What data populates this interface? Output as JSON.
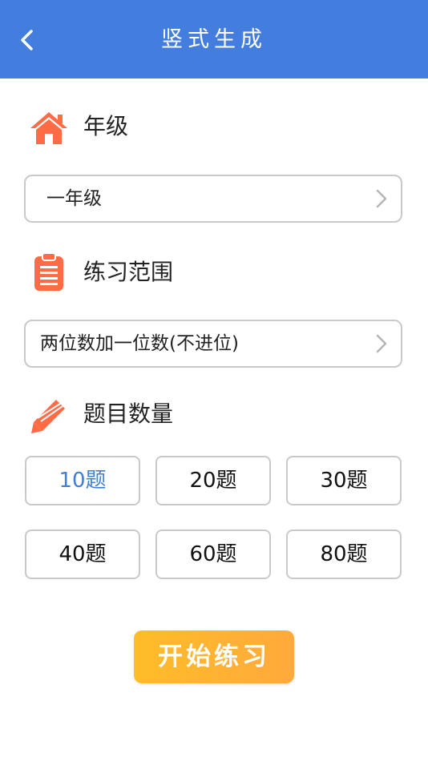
{
  "header": {
    "title": "竖式生成",
    "background_color": "#437ede"
  },
  "grade": {
    "title": "年级",
    "selected_value": "一年级"
  },
  "range": {
    "title": "练习范围",
    "selected_value": "两位数加一位数(不进位)"
  },
  "count": {
    "title": "题目数量",
    "options": [
      "10题",
      "20题",
      "30题",
      "40题",
      "60题",
      "80题"
    ],
    "selected_index": 0,
    "selected_color": "#3f7fd6"
  },
  "start_button": {
    "label": "开始练习",
    "color": "#ffb530"
  },
  "icons": {
    "back": "chevron-left-icon",
    "grade": "home-icon",
    "range": "clipboard-icon",
    "count": "pencil-icon",
    "select": "chevron-right-icon"
  },
  "accent_icon_color": "#ff6b45"
}
